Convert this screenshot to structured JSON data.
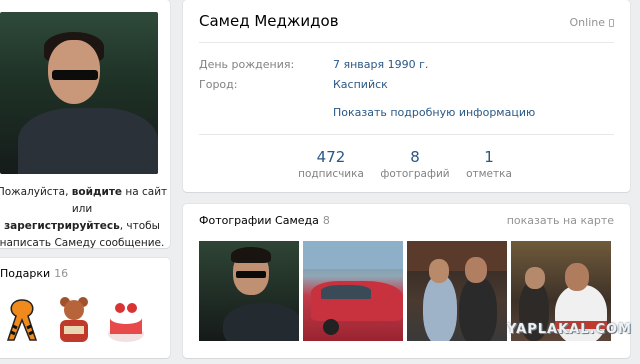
{
  "left": {
    "login_message": {
      "part1": "Пожалуйста, ",
      "login_link": "войдите",
      "part2": " на сайт или ",
      "register_link": "зарегистрируйтесь",
      "part3": ", чтобы написать Самеду сообщение."
    },
    "gifts": {
      "title": "Подарки",
      "count": "16"
    }
  },
  "profile": {
    "name": "Самед Меджидов",
    "status": "Online",
    "birthday_label": "День рождения:",
    "birthday_value": "7 января 1990 г.",
    "city_label": "Город:",
    "city_value": "Каспийск",
    "more_info": "Показать подробную информацию",
    "counters": [
      {
        "num": "472",
        "label": "подписчика"
      },
      {
        "num": "8",
        "label": "фотографий"
      },
      {
        "num": "1",
        "label": "отметка"
      }
    ]
  },
  "photos": {
    "title": "Фотографии Самеда",
    "count": "8",
    "map_link": "показать на карте"
  },
  "watermark": "YAPLAKAL.COM",
  "colors": {
    "link": "#2a5885",
    "muted": "#828282",
    "background": "#edeef0"
  }
}
